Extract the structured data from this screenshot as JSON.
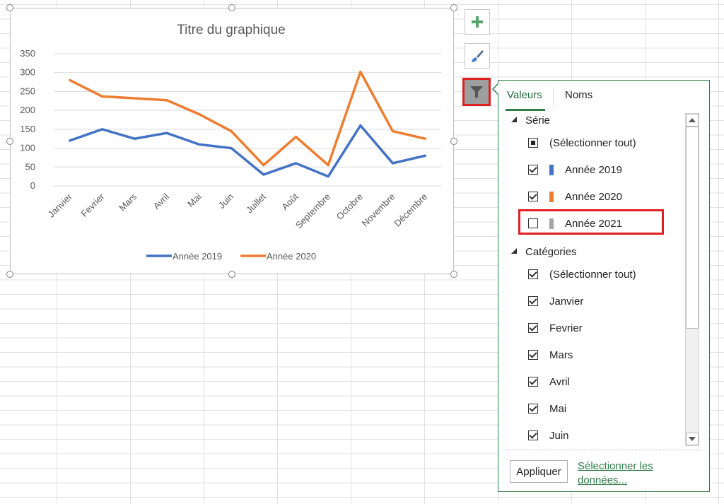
{
  "chart": {
    "title": "Titre du graphique",
    "legend_label_2019": "Année 2019",
    "legend_label_2020": "Année 2020"
  },
  "chart_data": {
    "type": "line",
    "title": "Titre du graphique",
    "categories": [
      "Janvier",
      "Fevrier",
      "Mars",
      "Avril",
      "Mai",
      "Juin",
      "Juillet",
      "Août",
      "Septembre",
      "Octobre",
      "Novembre",
      "Décembre"
    ],
    "yticks": [
      "0",
      "50",
      "100",
      "150",
      "200",
      "250",
      "300",
      "350"
    ],
    "ylim": [
      0,
      350
    ],
    "grid": true,
    "legend_position": "bottom",
    "series": [
      {
        "name": "Année 2019",
        "color": "#4472c4",
        "values": [
          120,
          150,
          125,
          140,
          110,
          100,
          30,
          60,
          25,
          160,
          60,
          80
        ]
      },
      {
        "name": "Année 2020",
        "color": "#ed7d31",
        "values": [
          280,
          237,
          232,
          227,
          190,
          145,
          55,
          130,
          55,
          302,
          145,
          125
        ]
      }
    ]
  },
  "side_buttons": {
    "elements_icon": "plus-icon",
    "styles_icon": "paintbrush-icon",
    "filter_icon": "funnel-icon"
  },
  "filter_panel": {
    "tab_values": "Valeurs",
    "tab_names": "Noms",
    "series_header": "Série",
    "series_items": [
      {
        "label": "(Sélectionner tout)",
        "state": "partial"
      },
      {
        "label": "Année 2019",
        "state": "checked",
        "color": "#4472c4"
      },
      {
        "label": "Année 2020",
        "state": "checked",
        "color": "#ed7d31"
      },
      {
        "label": "Année 2021",
        "state": "unchecked",
        "color": "#a5a5a5"
      }
    ],
    "categories_header": "Catégories",
    "category_items": [
      {
        "label": "(Sélectionner tout)",
        "state": "checked"
      },
      {
        "label": "Janvier",
        "state": "checked"
      },
      {
        "label": "Fevrier",
        "state": "checked"
      },
      {
        "label": "Mars",
        "state": "checked"
      },
      {
        "label": "Avril",
        "state": "checked"
      },
      {
        "label": "Mai",
        "state": "checked"
      },
      {
        "label": "Juin",
        "state": "checked"
      }
    ],
    "apply_label": "Appliquer",
    "select_data_link": "Sélectionner les données..."
  }
}
